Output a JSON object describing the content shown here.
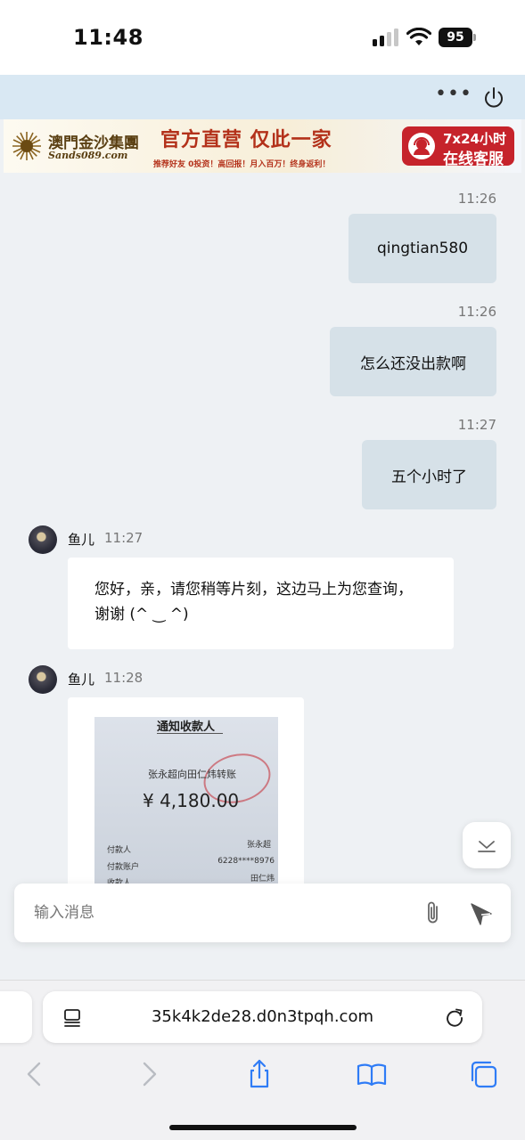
{
  "status_bar": {
    "time": "11:48",
    "battery": "95"
  },
  "banner": {
    "logo_cn": "澳門金沙集團",
    "logo_en": "Sands089.com",
    "slogan": "官方直营 仅此一家",
    "subline": "推荐好友 0投资！高回报！月入百万！终身返利！",
    "service_line1": "7x24小时",
    "service_line2": "在线客服"
  },
  "messages": {
    "m1_time": "11:26",
    "m1_text": "qingtian580",
    "m2_time": "11:26",
    "m2_text": "怎么还没出款啊",
    "m3_time": "11:27",
    "m3_text": "五个小时了",
    "m4_sender": "鱼儿",
    "m4_time": "11:27",
    "m4_text": "您好，亲，请您稍等片刻，这边马上为您查询，谢谢 (^ ‿ ^)",
    "m5_sender": "鱼儿",
    "m5_time": "11:28"
  },
  "receipt": {
    "title": "通知收款人",
    "description": "张永超向田仁炜转账",
    "amount": "¥ 4,180.00",
    "rows": [
      {
        "label": "付款人",
        "value": "张永超"
      },
      {
        "label": "付款账户",
        "value": "6228****8976"
      },
      {
        "label": "收款人",
        "value": "田仁炜"
      }
    ]
  },
  "composer": {
    "placeholder": "输入消息"
  },
  "browser": {
    "url": "35k4k2de28.d0n3tpqh.com"
  },
  "icons": {
    "more": "more-icon",
    "power": "power-icon",
    "scroll_down": "chevron-down-icon",
    "attach": "paperclip-icon",
    "send": "send-icon",
    "page_menu": "page-menu-icon",
    "reload": "reload-icon",
    "back": "back-icon",
    "forward": "forward-icon",
    "share": "share-icon",
    "bookmarks": "bookmarks-icon",
    "tabs": "tabs-icon"
  },
  "colors": {
    "accent": "#2f7cf6",
    "outgoing_bubble": "#d6e1e8",
    "banner_red": "#c6232b"
  }
}
